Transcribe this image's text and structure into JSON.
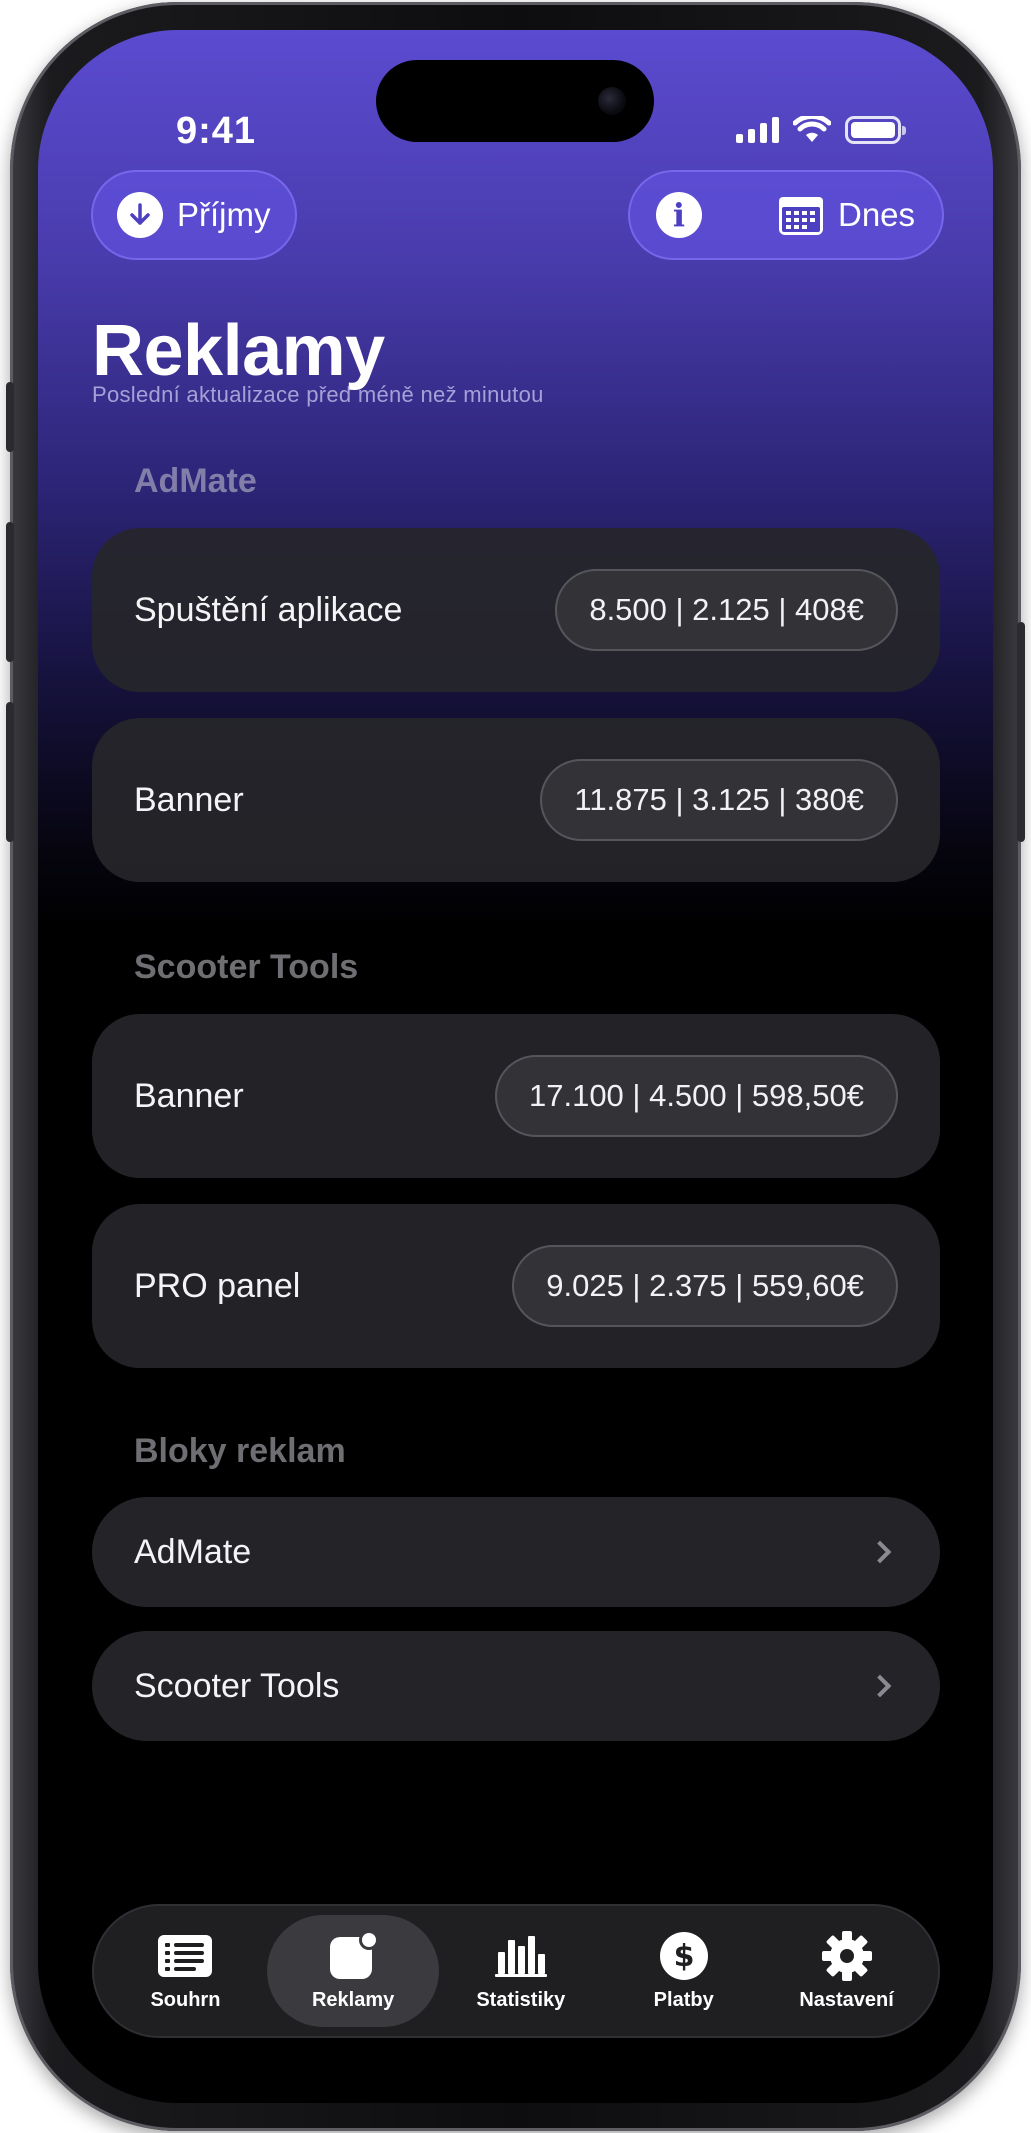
{
  "status_bar": {
    "time": "9:41"
  },
  "header": {
    "income_label": "Příjmy",
    "date_label": "Dnes",
    "title": "Reklamy",
    "subtitle": "Poslední aktualizace před méně než minutou"
  },
  "sections": [
    {
      "title": "AdMate",
      "rows": [
        {
          "label": "Spuštění aplikace",
          "value": "8.500 | 2.125 | 408€"
        },
        {
          "label": "Banner",
          "value": "11.875 | 3.125 | 380€"
        }
      ]
    },
    {
      "title": "Scooter Tools",
      "rows": [
        {
          "label": "Banner",
          "value": "17.100 | 4.500 | 598,50€"
        },
        {
          "label": "PRO panel",
          "value": "9.025 | 2.375 | 559,60€"
        }
      ]
    }
  ],
  "ad_blocks": {
    "title": "Bloky reklam",
    "items": [
      {
        "label": "AdMate"
      },
      {
        "label": "Scooter Tools"
      }
    ]
  },
  "tabbar": {
    "active": "Reklamy",
    "items": [
      {
        "label": "Souhrn",
        "icon": "list-icon"
      },
      {
        "label": "Reklamy",
        "icon": "ads-icon"
      },
      {
        "label": "Statistiky",
        "icon": "bar-chart-icon"
      },
      {
        "label": "Platby",
        "icon": "dollar-icon"
      },
      {
        "label": "Nastavení",
        "icon": "gear-icon"
      }
    ]
  },
  "colors": {
    "gradient_top": "#5b4bd0",
    "pill_bg": "#5f50dc",
    "card_bg": "#26262a",
    "value_pill_bg": "#333337"
  }
}
